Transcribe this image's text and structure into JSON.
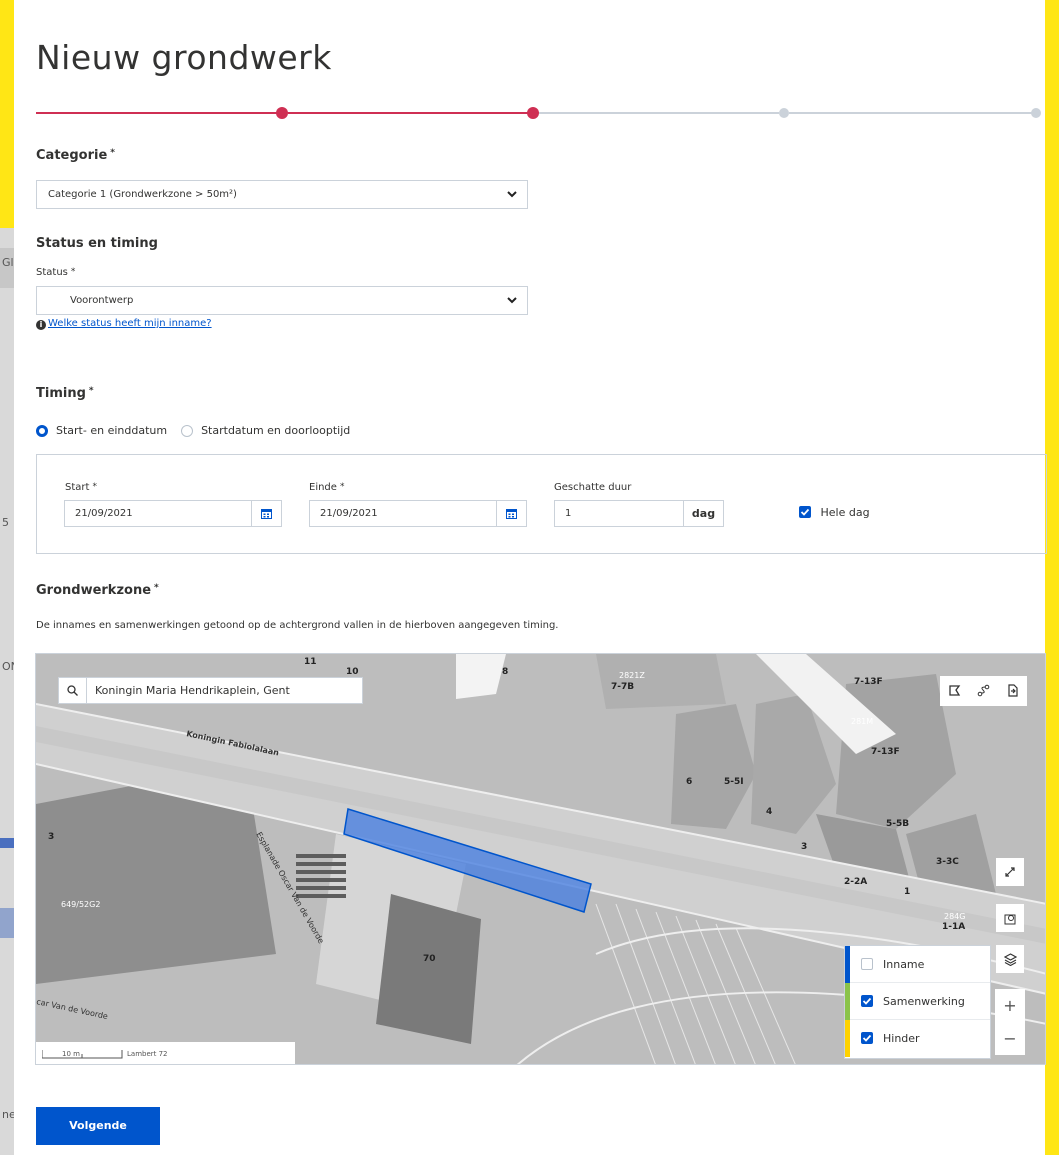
{
  "page": {
    "title": "Nieuw grondwerk"
  },
  "stepper": {
    "active_color": "#cf2f53",
    "inactive_color": "#cbd2da",
    "steps_total": 5,
    "current_step": 3
  },
  "categorie": {
    "label": "Categorie",
    "required_mark": "*",
    "value": "Categorie 1 (Grondwerkzone > 50m²)"
  },
  "status_timing": {
    "heading": "Status en timing",
    "status_label": "Status",
    "required_mark": "*",
    "status_value": "Voorontwerp",
    "help_link": "Welke status heeft mijn inname?"
  },
  "timing": {
    "heading": "Timing",
    "required_mark": "*",
    "options": [
      {
        "label": "Start- en einddatum",
        "selected": true
      },
      {
        "label": "Startdatum en doorlooptijd",
        "selected": false
      }
    ],
    "start_label": "Start",
    "start_value": "21/09/2021",
    "end_label": "Einde",
    "end_value": "21/09/2021",
    "duration_label": "Geschatte duur",
    "duration_value": "1",
    "duration_unit": "dag",
    "whole_day_label": "Hele dag",
    "whole_day_checked": true
  },
  "zone": {
    "heading": "Grondwerkzone",
    "required_mark": "*",
    "description": "De innames en samenwerkingen getoond op de achtergrond vallen in de hierboven aangegeven timing."
  },
  "map": {
    "search_value": "Koningin Maria Hendrikaplein, Gent",
    "street_labels": [
      "Koningin Fabiolalaan",
      "Esplanade Oscar Van de Voorde",
      "car Van de Voorde"
    ],
    "parcel_labels": [
      "11",
      "10",
      "8",
      "7-7B",
      "7-13F",
      "7-13F",
      "6",
      "5-5I",
      "4",
      "5-5B",
      "3",
      "3",
      "2-2A",
      "1",
      "3-3C",
      "1-1A",
      "70"
    ],
    "parcel_ids": [
      "2821Z",
      "281M",
      "649/52G2",
      "284G"
    ],
    "scale_label": "10 m",
    "projection_label": "Lambert 72",
    "layers": [
      {
        "label": "Inname",
        "checked": false,
        "color": "#0055cc"
      },
      {
        "label": "Samenwerking",
        "checked": true,
        "color": "#8bc34a"
      },
      {
        "label": "Hinder",
        "checked": true,
        "color": "#ffd200"
      }
    ],
    "zoom_in": "+",
    "zoom_out": "−"
  },
  "actions": {
    "next_label": "Volgende"
  },
  "background_page": {
    "texts": [
      "Gll",
      "ON",
      "5",
      "ne"
    ]
  }
}
